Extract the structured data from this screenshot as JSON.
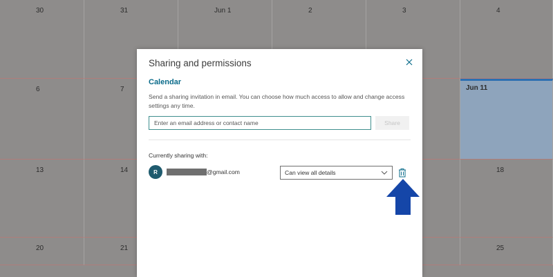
{
  "calendar": {
    "rows": [
      [
        "30",
        "31",
        "Jun 1",
        "2",
        "3",
        "4"
      ],
      [
        "6",
        "7",
        "",
        "",
        "",
        "Jun 11"
      ],
      [
        "13",
        "14",
        "",
        "",
        "",
        "18"
      ],
      [
        "20",
        "21",
        "",
        "",
        "",
        "25"
      ]
    ],
    "selected_date": "Jun 11"
  },
  "dialog": {
    "title": "Sharing and permissions",
    "calendar_name": "Calendar",
    "description": "Send a sharing invitation in email. You can choose how much access to allow and change access settings any time.",
    "email_placeholder": "Enter an email address or contact name",
    "share_label": "Share",
    "currently_sharing_label": "Currently sharing with:",
    "share_entry": {
      "avatar_initial": "R",
      "email_suffix": "@gmail.com",
      "permission": "Can view all details"
    }
  },
  "icons": {
    "close": "close-icon",
    "chevron": "chevron-down-icon",
    "delete": "trash-icon",
    "annotation": "up-arrow-annotation"
  },
  "colors": {
    "accent": "#0a6b8a",
    "avatar": "#1f5b6e",
    "arrow": "#1546a8",
    "selected_day_bg": "#8ea4bc"
  }
}
